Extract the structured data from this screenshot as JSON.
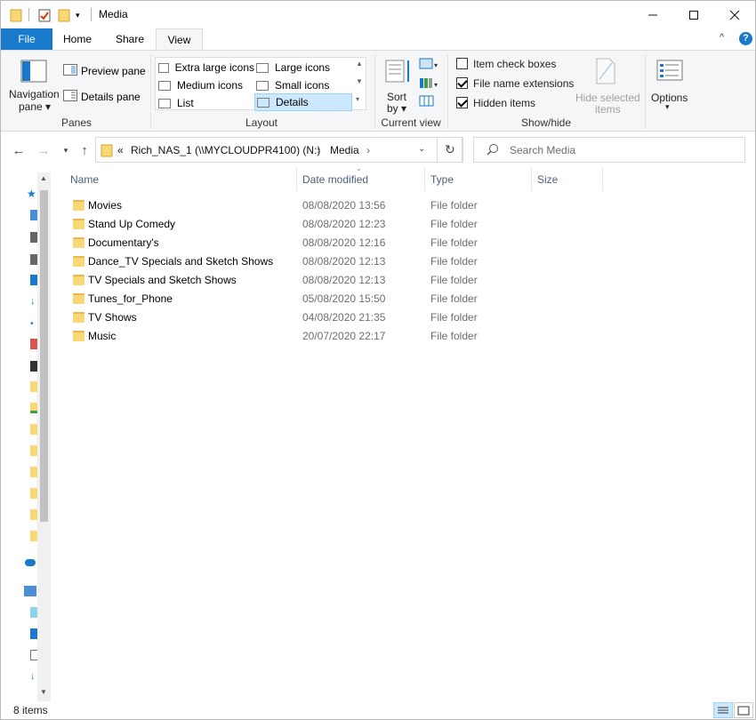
{
  "window": {
    "title": "Media"
  },
  "ribbon_tabs": {
    "file": "File",
    "home": "Home",
    "share": "Share",
    "view": "View"
  },
  "ribbon": {
    "panes": {
      "label": "Panes",
      "navigation_pane_line1": "Navigation",
      "navigation_pane_line2": "pane ▾",
      "preview_pane": "Preview pane",
      "details_pane": "Details pane"
    },
    "layout": {
      "label": "Layout",
      "items": [
        "Extra large icons",
        "Large icons",
        "Medium icons",
        "Small icons",
        "List",
        "Details"
      ],
      "selected": "Details"
    },
    "current_view": {
      "label": "Current view",
      "sort_line1": "Sort",
      "sort_line2": "by ▾"
    },
    "show_hide": {
      "label": "Show/hide",
      "item_check_boxes": "Item check boxes",
      "item_check_boxes_checked": false,
      "file_name_extensions": "File name extensions",
      "file_name_extensions_checked": true,
      "hidden_items": "Hidden items",
      "hidden_items_checked": true,
      "hide_selected_line1": "Hide selected",
      "hide_selected_line2": "items"
    },
    "options_line1": "Options",
    "options_line2": "▾"
  },
  "address": {
    "overflow": "«",
    "crumbs": [
      "Rich_NAS_1 (\\\\MYCLOUDPR4100) (N:)",
      "Media"
    ],
    "separator": "›"
  },
  "search": {
    "placeholder": "Search Media"
  },
  "columns": {
    "name": "Name",
    "date": "Date modified",
    "type": "Type",
    "size": "Size"
  },
  "files": [
    {
      "name": "Movies",
      "date": "08/08/2020 13:56",
      "type": "File folder"
    },
    {
      "name": "Stand Up Comedy",
      "date": "08/08/2020 12:23",
      "type": "File folder"
    },
    {
      "name": "Documentary's",
      "date": "08/08/2020 12:16",
      "type": "File folder"
    },
    {
      "name": "Dance_TV Specials and Sketch Shows",
      "date": "08/08/2020 12:13",
      "type": "File folder"
    },
    {
      "name": "TV Specials and Sketch Shows",
      "date": "08/08/2020 12:13",
      "type": "File folder"
    },
    {
      "name": "Tunes_for_Phone",
      "date": "05/08/2020 15:50",
      "type": "File folder"
    },
    {
      "name": "TV Shows",
      "date": "04/08/2020 21:35",
      "type": "File folder"
    },
    {
      "name": "Music",
      "date": "20/07/2020 22:17",
      "type": "File folder"
    }
  ],
  "status": {
    "item_count": "8 items"
  },
  "colors": {
    "accent": "#1979ca",
    "selection": "#cce8ff",
    "folder": "#f8d775"
  }
}
